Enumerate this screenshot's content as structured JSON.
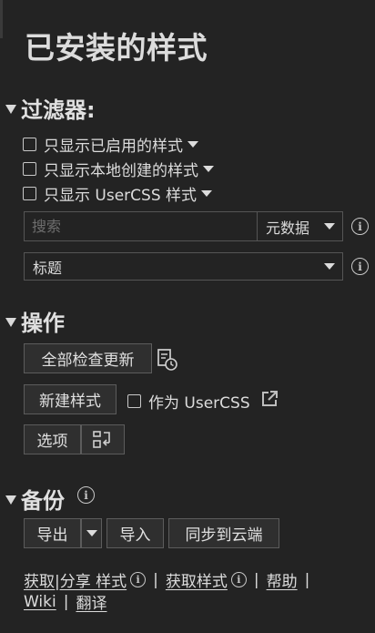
{
  "page": {
    "title": "已安装的样式"
  },
  "filters": {
    "heading": "过滤器:",
    "checkboxes": [
      {
        "label": "只显示已启用的样式",
        "checked": false
      },
      {
        "label": "只显示本地创建的样式",
        "checked": false
      },
      {
        "label": "只显示 UserCSS 样式",
        "checked": false
      }
    ],
    "search_placeholder": "搜索",
    "search_scope": "元数据",
    "sort_by": "标题"
  },
  "actions": {
    "heading": "操作",
    "check_updates": "全部检查更新",
    "new_style": "新建样式",
    "as_usercss": "作为 UserCSS",
    "options": "选项"
  },
  "backup": {
    "heading": "备份",
    "export": "导出",
    "import": "导入",
    "sync": "同步到云端"
  },
  "footer": {
    "get_share": "获取|分享 样式",
    "get_styles": "获取样式",
    "help": "帮助",
    "wiki": "Wiki",
    "translate": "翻译",
    "separator": "|"
  }
}
